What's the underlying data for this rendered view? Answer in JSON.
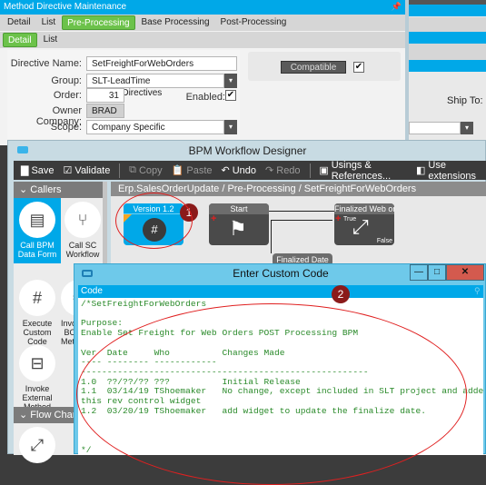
{
  "method_directive": {
    "title": "Method Directive Maintenance",
    "pin_icon": "pin-icon",
    "tabs": [
      {
        "label": "Detail",
        "active": false
      },
      {
        "label": "List",
        "active": false
      },
      {
        "label": "Pre-Processing",
        "active": true
      },
      {
        "label": "Base Processing",
        "active": false
      },
      {
        "label": "Post-Processing",
        "active": false
      }
    ],
    "subtabs": [
      {
        "label": "Detail",
        "active": true
      },
      {
        "label": "List",
        "active": false
      }
    ],
    "fields": {
      "directive_name_label": "Directive Name:",
      "directive_name_value": "SetFreightForWebOrders",
      "group_label": "Group:",
      "group_value": "SLT-LeadTime MethodDirectives",
      "order_label": "Order:",
      "order_value": "31",
      "enabled_label": "Enabled:",
      "enabled_checked": true,
      "owner_company_label": "Owner Company:",
      "owner_company_value": "BRAD",
      "scope_label": "Scope:",
      "scope_value": "Company Specific"
    },
    "compatible_label": "Compatible",
    "compatible_checked": true
  },
  "background_window": {
    "ship_to_label": "Ship To:"
  },
  "bpm_designer": {
    "title": "BPM Workflow Designer",
    "toolbar": [
      {
        "label": "Save",
        "icon": "save-icon",
        "enabled": true
      },
      {
        "label": "Validate",
        "icon": "validate-icon",
        "enabled": true
      },
      {
        "label": "Copy",
        "icon": "copy-icon",
        "enabled": false
      },
      {
        "label": "Paste",
        "icon": "paste-icon",
        "enabled": false
      },
      {
        "label": "Undo",
        "icon": "undo-icon",
        "enabled": true
      },
      {
        "label": "Redo",
        "icon": "redo-icon",
        "enabled": false
      },
      {
        "label": "Usings & References...",
        "icon": "references-icon",
        "enabled": true
      },
      {
        "label": "Use extensions",
        "icon": "extensions-icon",
        "enabled": true
      }
    ],
    "palette": {
      "callers_header": "Callers",
      "items": [
        {
          "label": "Call BPM Data Form",
          "icon": "data-form-icon",
          "selected": true
        },
        {
          "label": "Call SC Workflow",
          "icon": "workflow-icon",
          "selected": false
        },
        {
          "label": "Execute Custom Code",
          "icon": "custom-code-icon",
          "selected": false
        },
        {
          "label": "Invoke BO Method",
          "icon": "invoke-bo-icon",
          "selected": false
        },
        {
          "label": "Invoke External Method",
          "icon": "external-method-icon",
          "selected": false
        }
      ],
      "flowchart_header": "Flow Chart"
    },
    "breadcrumb": "Erp.SalesOrderUpdate / Pre-Processing / SetFreightForWebOrders",
    "nodes": {
      "version": "Version 1.2",
      "start": "Start",
      "finalized_web": "Finalized Web orde",
      "finalized_date": "Finalized Date",
      "true_label": "True",
      "false_label": "False"
    },
    "annotation_1": "1"
  },
  "custom_code": {
    "title": "Enter Custom Code",
    "code_header": "Code",
    "annotation_2": "2",
    "code_lines": "/*SetFreightForWebOrders\n\nPurpose:\nEnable Set Freight for Web Orders POST Processing BPM\n\nVer  Date     Who          Changes Made\n---- -------- ------------\n-------------------------------------------------------\n1.0  ??/??/?? ???          Initial Release\n1.1  03/14/19 TShoemaker   No change, except included in SLT project and added\nthis rev control widget\n1.2  03/20/19 TShoemaker   add widget to update the finalize date.\n\n\n\n*/"
  }
}
